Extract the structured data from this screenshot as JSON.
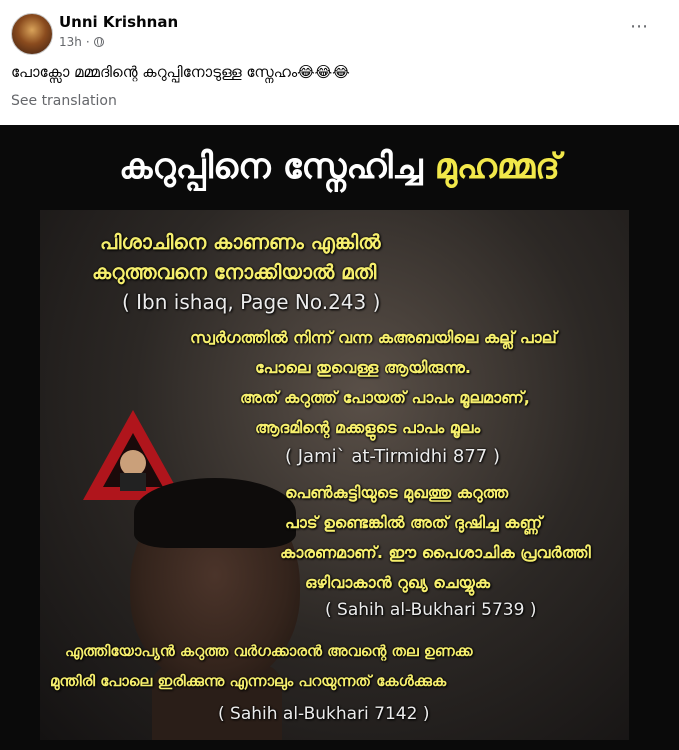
{
  "post": {
    "author": "Unni Krishnan",
    "time": "13h",
    "more_icon": "⋯",
    "caption": "പോക്സോ മമ്മദിന്റെ കറുപ്പിനോടുള്ള സ്നേഹം😂😂😂",
    "see_translation": "See translation"
  },
  "image": {
    "title_white": "കറുപ്പിനെ സ്നേഹിച്ച ",
    "title_yellow": "മുഹമ്മദ്",
    "lines": [
      "പിശാചിനെ കാണണം എങ്കിൽ",
      "കറുത്തവനെ നോക്കിയാൽ മതി",
      "( Ibn ishaq, Page No.243 )",
      "സ്വർഗത്തിൽ നിന്ന് വന്ന കഅബയിലെ കല്ല് പാല്",
      "പോലെ തുവെള്ള ആയിരുന്നു.",
      "അത് കറുത്ത് പോയത് പാപം മൂലമാണ്,",
      "ആദമിന്റെ മക്കളുടെ പാപം മൂലം",
      "( Jami` at-Tirmidhi 877 )",
      "പെൺകുട്ടിയുടെ മുഖത്തു കറുത്ത",
      "പാട് ഉണ്ടെങ്കിൽ അത് ദുഷിച്ച കണ്ണ്",
      "കാരണമാണ്. ഈ പൈശാചിക പ്രവർത്തി",
      "ഒഴിവാകാൻ റുഖ്യ ചെയ്യുക",
      "( Sahih al-Bukhari 5739 )",
      "എത്തിയോപ്യൻ കറുത്ത വർഗക്കാരൻ അവന്റെ തല ഉണക്ക",
      "മുന്തിരി പോലെ ഇരിക്കുന്നു എന്നാലും പറയുന്നത് കേൾക്കുക",
      "( Sahih al-Bukhari 7142 )"
    ]
  }
}
